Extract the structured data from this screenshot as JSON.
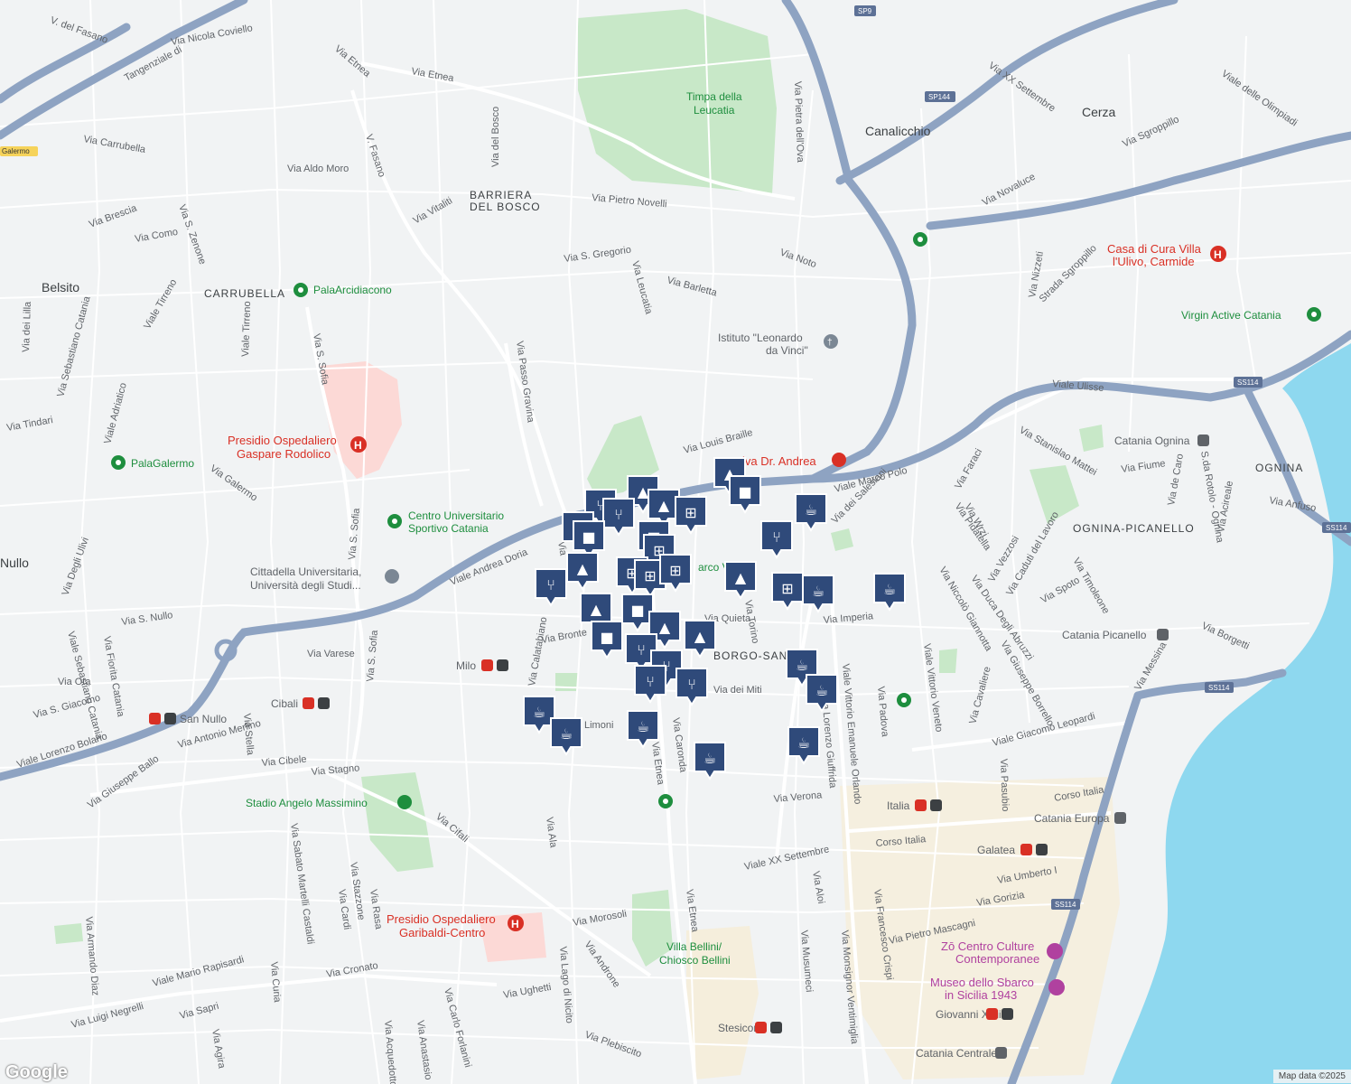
{
  "colors": {
    "land": "#f1f3f4",
    "water": "#8ed8ef",
    "highway": "#8ea3c2",
    "park": "#c8e8c8",
    "hospital": "#fcd9d6",
    "marker_fill": "#2f4a7a"
  },
  "areas": {
    "barriera": "BARRIERA",
    "del_bosco": "DEL BOSCO",
    "carrubella": "CARRUBELLA",
    "ognina": "OGNINA",
    "ognina_picanello": "OGNINA-PICANELLO",
    "borgo": "BORGO-SAN",
    "canalicchio": "Canalicchio",
    "cerza": "Cerza",
    "belsito": "Belsito",
    "nullo": "Nullo"
  },
  "pois": {
    "timpa1": "Timpa della",
    "timpa2": "Leucatia",
    "palaarcidiacono": "PalaArcidiacono",
    "presidio1": "Presidio Ospedaliero",
    "presidio2": "Gaspare Rodolico",
    "palagalermo": "PalaGalermo",
    "centro1": "Centro Universitario",
    "centro2": "Sportivo Catania",
    "cittadella1": "Cittadella Universitaria,",
    "cittadella2": "Università degli Studi...",
    "istituto1": "Istituto \"Leonardo",
    "istituto2": "da Vinci\"",
    "casa1": "Casa di Cura Villa",
    "casa2": "l'Ulivo, Carmide",
    "virgin": "Virgin Active Catania",
    "catania_ognina": "Catania Ognina",
    "catania_picanello": "Catania Picanello",
    "catania_europa": "Catania Europa",
    "galatea": "Galatea",
    "italia": "Italia",
    "milo": "Milo",
    "cibali": "Cibali",
    "san_nullo": "San Nullo",
    "stadio": "Stadio Angelo Massimino",
    "garibaldi1": "Presidio Ospedaliero",
    "garibaldi2": "Garibaldi-Centro",
    "villa1": "Villa Bellini/",
    "villa2": "Chiosco Bellini",
    "stesicoro": "Stesicoro",
    "zo1": "Zō Centro Culture",
    "zo2": "Contemporanee",
    "museo1": "Museo dello Sbarco",
    "museo2": "in Sicilia 1943",
    "giovanni": "Giovanni Xxiii",
    "catania_centrale": "Catania Centrale",
    "andrea": "iva Dr. Andrea",
    "parco": "arco Vu"
  },
  "shields": {
    "sp9": "SP9",
    "sp144": "SP144",
    "ss114_a": "SS114",
    "ss114_b": "SS114",
    "ss114_c": "SS114",
    "ss114_d": "SS114",
    "galermo": "Galermo"
  },
  "streets": {
    "tangenziale": "Tangenziale di",
    "coviello": "Via Nicola Coviello",
    "etnea_n": "Via Etnea",
    "etnea_n2": "Via Etnea",
    "fasano": "V. del Fasano",
    "carrubella": "Via Carrubella",
    "aldo_moro": "Via Aldo Moro",
    "brescia": "Via Brescia",
    "como": "Via Como",
    "zenone": "Via S. Zenone",
    "vitaliti": "Via Vitaliti",
    "del_bosco": "Via del Bosco",
    "v_fasano": "V. Fasano",
    "pietro_novelli": "Via Pietro Novelli",
    "s_gregorio": "Via S. Gregorio",
    "leucatia": "Via Leucatia",
    "barletta": "Via Barletta",
    "noto": "Via Noto",
    "pietra_ova": "Via Pietra dell'Ova",
    "xx_settembre_n": "Via XX Settembre",
    "novaluce": "Via Novaluce",
    "sgroppillo": "Via Sgroppillo",
    "olimpiadi": "Viale delle Olimpiadi",
    "nizzeti": "Via Nizzeti",
    "strada_sgroppillo": "Strada Sgroppillo",
    "tirreno": "Viale Tirreno",
    "tirreno2": "Viale Tirreno",
    "lilla": "Via dei Lilla",
    "sebastiano": "Via Sebastiano Catania",
    "adriatico": "Viale Adriatico",
    "tindari": "Via Tindari",
    "s_sofia": "Via S. Sofia",
    "s_sofia2": "Via S. Sofia",
    "s_sofia3": "Via S. Sofia",
    "passo_gravina": "Via Passo Gravina",
    "galermo": "Via Galermo",
    "louis_braille": "Via Louis Braille",
    "ulisse": "Viale Ulisse",
    "marco_polo": "Viale Marco Polo",
    "salesiani": "Via dei Salesiani",
    "andrea_doria": "Viale Andrea Doria",
    "faraci": "Via Faraci",
    "stanislao": "Via Stanislao Mattei",
    "fiume": "Via Fiume",
    "de_caro": "Via de Caro",
    "rotolo": "S.da Rotolo - Ognina",
    "acireale": "Via Acireale",
    "anfuso": "Via Anfuso",
    "wrzi": "Via Wrzi",
    "pidatella": "Via Pidatella",
    "vezzosi": "Via Vezzosi",
    "caduti": "Via Caduti del Lavoro",
    "timoleone": "Via Timoleone",
    "spoto": "Via Spoto",
    "giannotta": "Via Niccolò Giannotta",
    "duca": "Via Duca Degli Abruzzi",
    "borgetti": "Via Borgetti",
    "messina": "Via Messina",
    "imperia": "Via Imperia",
    "padova": "Via Padova",
    "vittorio_veneto": "Viale Vittorio Veneto",
    "cavaliere": "Via Cavaliere",
    "borrello": "Via Giuseppe Borrello",
    "leopardi": "Viale Giacomo Leopardi",
    "pasubio": "Via Pasubio",
    "corso_italia": "Corso Italia",
    "corso_italia2": "Corso Italia",
    "umberto": "Via Umberto I",
    "gorizia": "Via Gorizia",
    "mascagni": "Via Pietro Mascagni",
    "crispi": "Via Francesco Crispi",
    "ventimiglia": "Via Monsignor Ventimiglia",
    "orlando": "Viale Vittorio Emanuele Orlando",
    "giuffrida": "Via Lorenzo Giuffrida",
    "verona": "Via Verona",
    "xx_settembre": "Viale XX Settembre",
    "aloi": "Via Aloi",
    "musumeci": "Via Musumeci",
    "etnea": "Via Etnea",
    "etnea2": "Via Etnea",
    "caronda": "Via Caronda",
    "limoni": "Limoni",
    "ala": "Via Ala",
    "cifali": "Via Cifali",
    "morosoli": "Via Morosoli",
    "androne": "Via Androne",
    "lago_nicito": "Via Lago di Nicito",
    "plebiscito": "Via Plebiscito",
    "ughetti": "Via Ughetti",
    "forlanini": "Via Carlo Forlanini",
    "anastasio": "Via Anastasio",
    "acquedotto": "Via Acquedotto",
    "cronato": "Via Cronato",
    "rasa": "Via Rasa",
    "cardi": "Via Cardi",
    "stazzone": "Via Stazzone",
    "sabato": "Via Sabato Martelli Castaldi",
    "curia": "Via Curia",
    "rapisardi": "Viale Mario Rapisardi",
    "sapri": "Via Sapri",
    "agira": "Via Agira",
    "negrelli": "Via Luigi Negrelli",
    "diaz": "Via Armando Diaz",
    "ballo": "Via Giuseppe Ballo",
    "lorenzo_bolano": "Viale Lorenzo Bolano",
    "merlino": "Via Antonio Merlino",
    "cibele": "Via Cibele",
    "stagno": "Via Stagno",
    "stella": "Via Stella",
    "s_giacomo": "Via S. Giacomo",
    "ota": "Via Ota",
    "varese": "Via Varese",
    "s_nullo": "Via S. Nullo",
    "ulivi": "Via Degli Ulivi",
    "fiorita": "Via Fiorita Catania",
    "sebastiano2": "Viale Sebastiano Catania",
    "bronte": "Via Bronte",
    "calatabiano": "Via Calatabiano",
    "quieta": "Via Quieta",
    "miti": "Via dei Miti",
    "torino": "Via Torino",
    "vie": "Via"
  },
  "attribution": "Map data ©2025",
  "logo": "Google"
}
